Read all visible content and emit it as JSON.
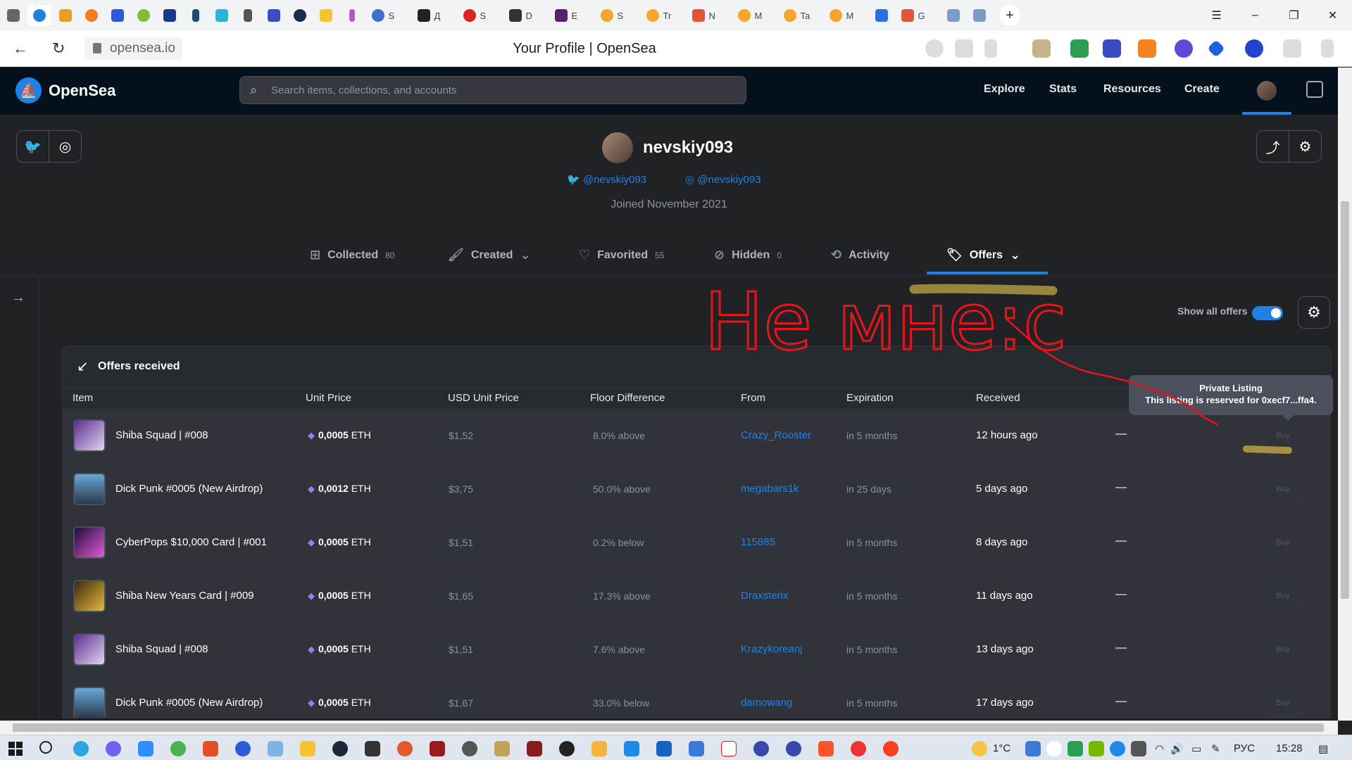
{
  "browser": {
    "url": "opensea.io",
    "page_title": "Your Profile | OpenSea",
    "tab_labels": [
      "S",
      "Д",
      "S",
      "D",
      "E",
      "S",
      "Tr",
      "N",
      "M",
      "Ta",
      "M",
      "G"
    ],
    "window_controls": [
      "–",
      "❐",
      "✕"
    ]
  },
  "header": {
    "brand": "OpenSea",
    "search_placeholder": "Search items, collections, and accounts",
    "nav": [
      "Explore",
      "Stats",
      "Resources",
      "Create"
    ]
  },
  "profile": {
    "username": "nevskiy093",
    "twitter_handle": "@nevskiy093",
    "instagram_handle": "@nevskiy093",
    "joined": "Joined November 2021"
  },
  "tabs": [
    {
      "label": "Collected",
      "count": "80",
      "icon": "collected-icon"
    },
    {
      "label": "Created",
      "count": "",
      "icon": "brush-icon"
    },
    {
      "label": "Favorited",
      "count": "55",
      "icon": "heart-icon"
    },
    {
      "label": "Hidden",
      "count": "0",
      "icon": "eye-off-icon"
    },
    {
      "label": "Activity",
      "count": "",
      "icon": "history-icon"
    },
    {
      "label": "Offers",
      "count": "",
      "icon": "tag-icon",
      "active": true
    }
  ],
  "offers": {
    "show_all_label": "Show all offers",
    "show_all_on": true,
    "panel_title": "Offers received",
    "columns": [
      "Item",
      "Unit Price",
      "USD Unit Price",
      "Floor Difference",
      "From",
      "Expiration",
      "Received"
    ],
    "rows": [
      {
        "item": "Shiba Squad | #008",
        "price": "0,0005",
        "unit": "ETH",
        "usd": "$1,52",
        "diff": "8.0% above",
        "from": "Crazy_Rooster",
        "exp": "in 5 months",
        "received": "12 hours ago",
        "dash": "—",
        "buy": "Buy"
      },
      {
        "item": "Dick Punk #0005 (New Airdrop)",
        "price": "0,0012",
        "unit": "ETH",
        "usd": "$3,75",
        "diff": "50.0% above",
        "from": "megabars1k",
        "exp": "in 25 days",
        "received": "5 days ago",
        "dash": "—",
        "buy": "Buy"
      },
      {
        "item": "CyberPops $10,000 Card | #001",
        "price": "0,0005",
        "unit": "ETH",
        "usd": "$1,51",
        "diff": "0.2% below",
        "from": "115885",
        "exp": "in 5 months",
        "received": "8 days ago",
        "dash": "—",
        "buy": "Buy"
      },
      {
        "item": "Shiba New Years Card | #009",
        "price": "0,0005",
        "unit": "ETH",
        "usd": "$1,65",
        "diff": "17.3% above",
        "from": "Draxsterix",
        "exp": "in 5 months",
        "received": "11 days ago",
        "dash": "—",
        "buy": "Buy"
      },
      {
        "item": "Shiba Squad | #008",
        "price": "0,0005",
        "unit": "ETH",
        "usd": "$1,51",
        "diff": "7.6% above",
        "from": "Krazykoreanj",
        "exp": "in 5 months",
        "received": "13 days ago",
        "dash": "—",
        "buy": "Buy"
      },
      {
        "item": "Dick Punk #0005 (New Airdrop)",
        "price": "0,0005",
        "unit": "ETH",
        "usd": "$1,67",
        "diff": "33.0% below",
        "from": "damowang",
        "exp": "in 5 months",
        "received": "17 days ago",
        "dash": "—",
        "buy": "Buy"
      }
    ],
    "tooltip": {
      "title": "Private Listing",
      "body": "This listing is reserved for 0xecf7...ffa4."
    }
  },
  "annotation": {
    "handwritten_text": "Не мне:с",
    "color": "#e8141a"
  },
  "taskbar": {
    "temperature": "1°C",
    "language": "РУС",
    "time": "15:28"
  },
  "colors": {
    "accent": "#2081e2",
    "header_bg": "#04111d",
    "page_bg": "#202225",
    "row_bg": "#303339",
    "highlight": "#a39040"
  }
}
